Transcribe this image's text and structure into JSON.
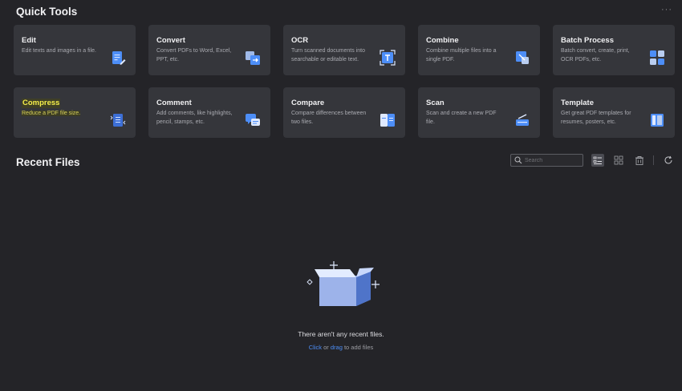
{
  "quick_tools": {
    "title": "Quick Tools",
    "more_label": "···",
    "cards": [
      {
        "title": "Edit",
        "desc": "Edit texts and images in a file.",
        "icon": "edit-doc-icon"
      },
      {
        "title": "Convert",
        "desc": "Convert PDFs to Word, Excel, PPT, etc.",
        "icon": "convert-icon"
      },
      {
        "title": "OCR",
        "desc": "Turn scanned documents into searchable or editable text.",
        "icon": "ocr-scan-icon"
      },
      {
        "title": "Combine",
        "desc": "Combine multiple files into a single PDF.",
        "icon": "combine-icon"
      },
      {
        "title": "Batch Process",
        "desc": "Batch convert, create, print, OCR PDFs, etc.",
        "icon": "batch-grid-icon"
      },
      {
        "title": "Compress",
        "desc": "Reduce a PDF file size.",
        "icon": "compress-icon"
      },
      {
        "title": "Comment",
        "desc": "Add comments, like highlights, pencil, stamps, etc.",
        "icon": "comment-icon"
      },
      {
        "title": "Compare",
        "desc": "Compare differences between two files.",
        "icon": "compare-icon"
      },
      {
        "title": "Scan",
        "desc": "Scan and create a new PDF file.",
        "icon": "scanner-icon"
      },
      {
        "title": "Template",
        "desc": "Get great PDF templates for resumes, posters, etc.",
        "icon": "template-icon"
      }
    ]
  },
  "recent_files": {
    "title": "Recent Files",
    "search_placeholder": "Search",
    "empty_text": "There aren't any recent files.",
    "click_label": "Click",
    "or_label": "or",
    "drag_label": "drag",
    "to_add_label": "to add files"
  },
  "colors": {
    "background": "#242428",
    "card": "#35363b",
    "accent_blue": "#4d8ef7",
    "highlight_yellow": "#f5ee4a"
  }
}
